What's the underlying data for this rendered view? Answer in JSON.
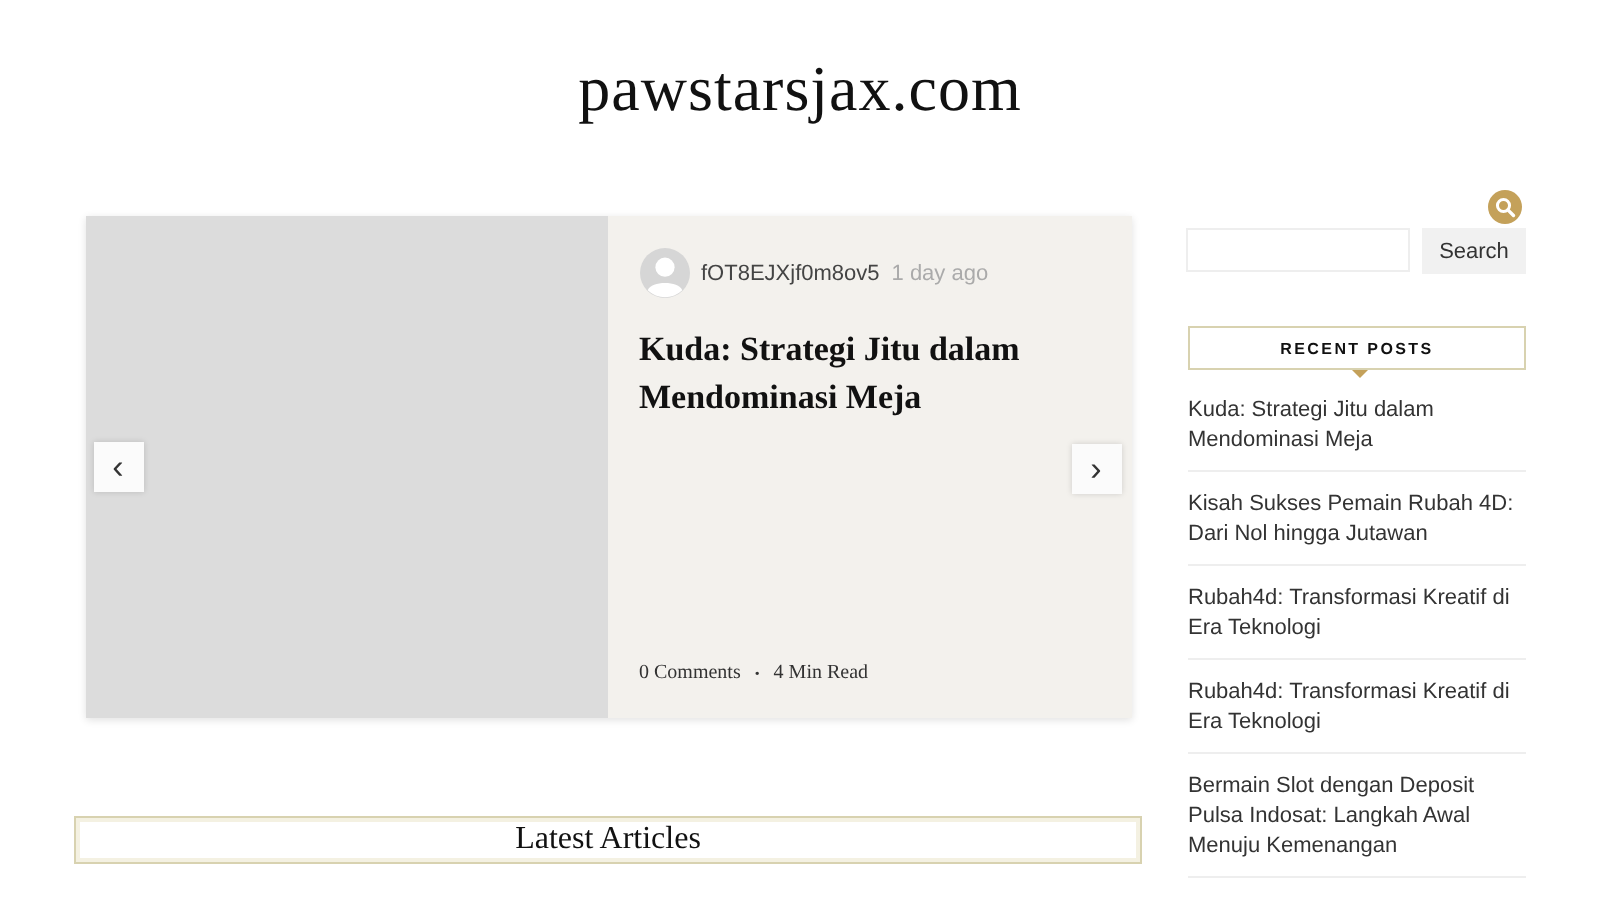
{
  "site_title": "pawstarsjax.com",
  "slider": {
    "prev": "‹",
    "next": "›",
    "author": "fOT8EJXjf0m8ov5",
    "time": "1 day ago",
    "title": "Kuda: Strategi Jitu dalam Mendominasi Meja",
    "comments": "0 Comments",
    "separator": "•",
    "read_time": "4 Min Read"
  },
  "search": {
    "button": "Search"
  },
  "recent_posts": {
    "heading": "RECENT POSTS",
    "items": [
      {
        "title": "Kuda: Strategi Jitu dalam Mendominasi Meja"
      },
      {
        "title": "Kisah Sukses Pemain Rubah 4D: Dari Nol hingga Jutawan"
      },
      {
        "title": "Rubah4d: Transformasi Kreatif di Era Teknologi"
      },
      {
        "title": "Rubah4d: Transformasi Kreatif di Era Teknologi"
      },
      {
        "title": "Bermain Slot dengan Deposit Pulsa Indosat: Langkah Awal Menuju Kemenangan"
      }
    ]
  },
  "latest_heading": "Latest Articles"
}
